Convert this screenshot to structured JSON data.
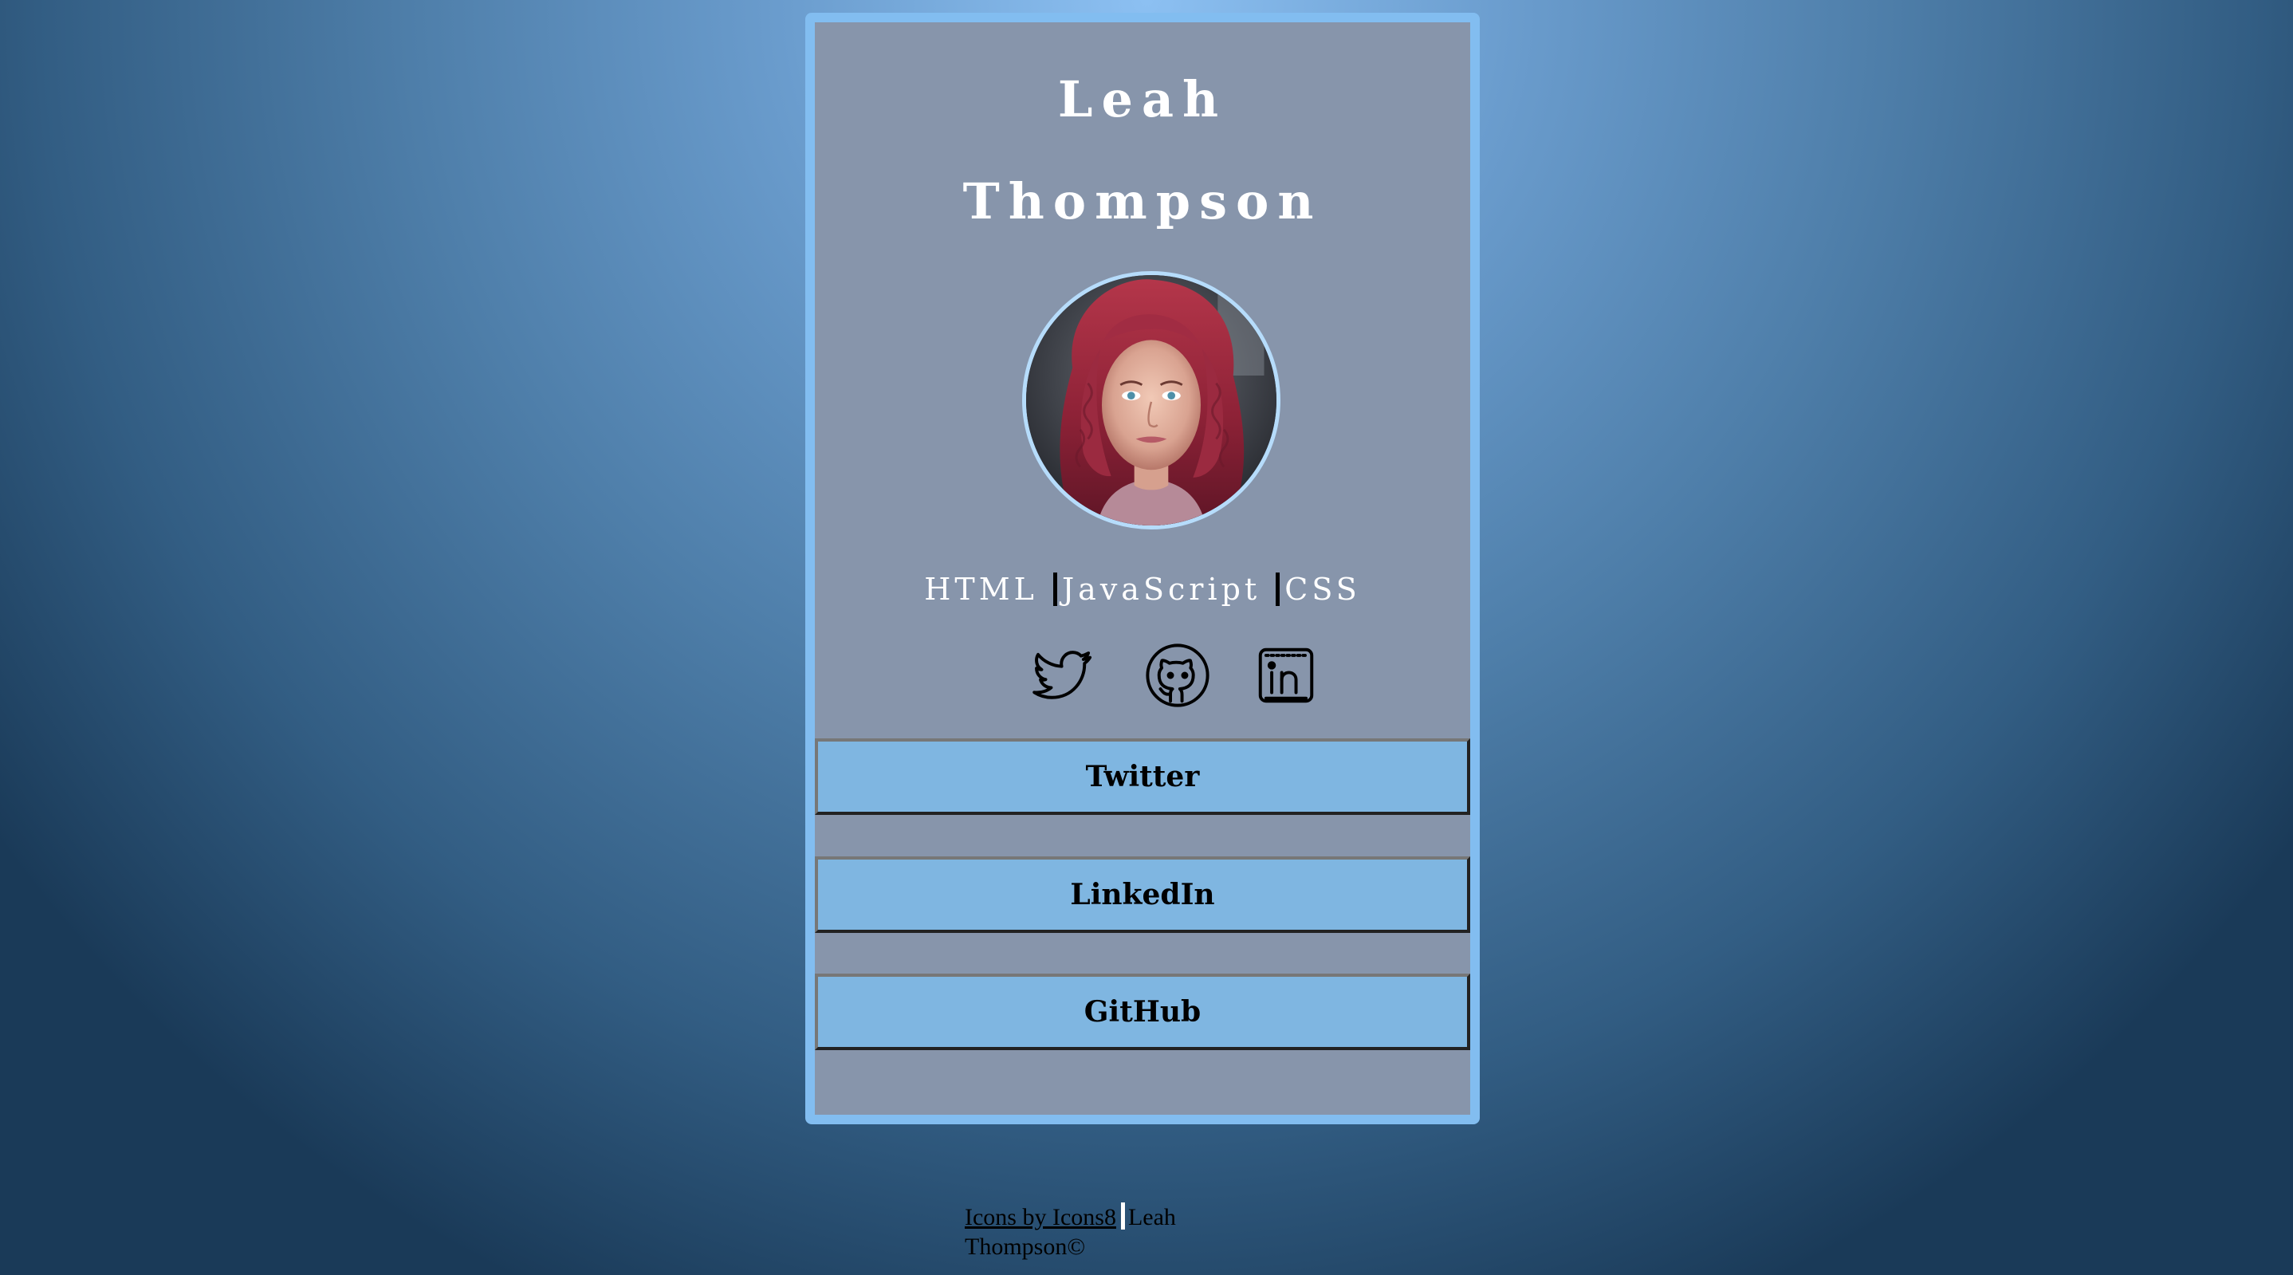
{
  "profile": {
    "first_name": "Leah",
    "last_name": "Thompson",
    "skills": [
      "HTML ",
      "JavaScript ",
      "CSS"
    ]
  },
  "social_icons": [
    {
      "name": "twitter-icon"
    },
    {
      "name": "github-icon"
    },
    {
      "name": "linkedin-icon"
    }
  ],
  "links": {
    "twitter": "Twitter",
    "linkedin": "LinkedIn",
    "github": "GitHub"
  },
  "footer": {
    "credit_link": "Icons by Icons8",
    "copyright": "Leah Thompson©"
  },
  "colors": {
    "card_border": "#82bdf0",
    "card_background": "#8795ab",
    "button_background": "#7fb6e1",
    "name_text": "#ffffff"
  }
}
